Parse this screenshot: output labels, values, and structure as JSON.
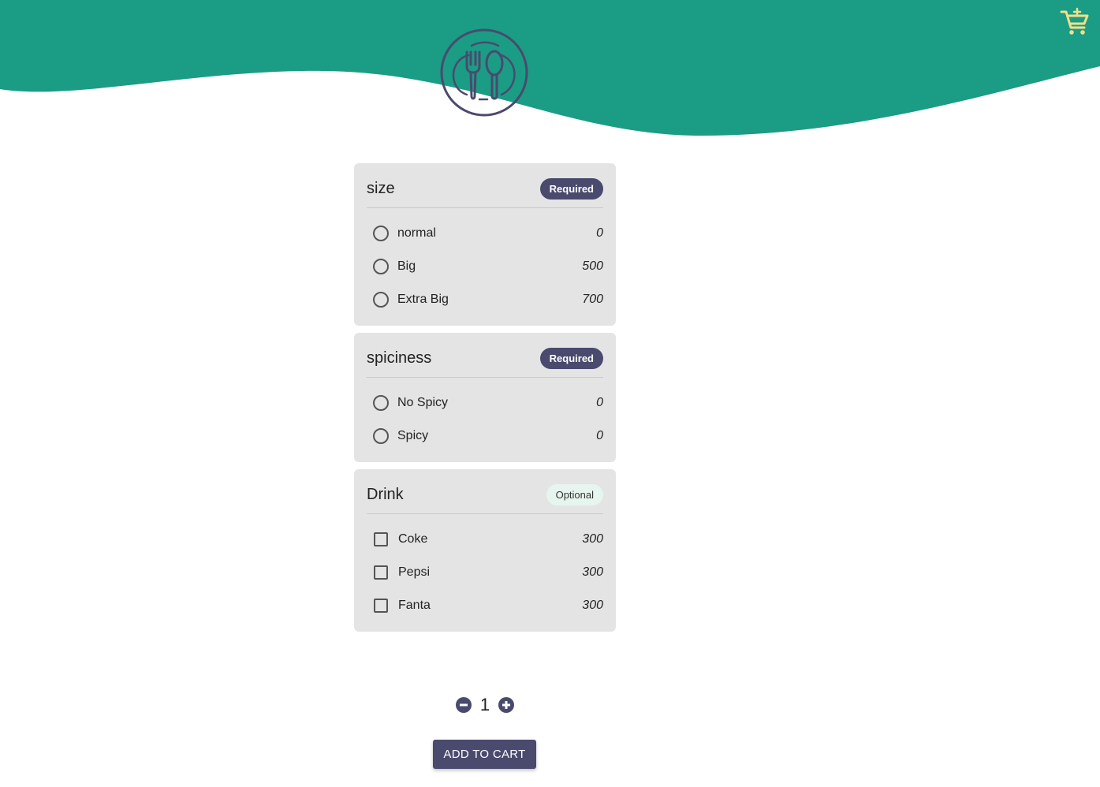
{
  "colors": {
    "header": "#1b9c85",
    "accent": "#4a4a6e",
    "cart": "#f2df8a",
    "panel": "#e4e4e4"
  },
  "header": {
    "logo_icon": "fork-spoon-logo-icon",
    "cart_icon": "add-to-cart-icon"
  },
  "groups": [
    {
      "title": "size",
      "badge": "Required",
      "input_type": "radio",
      "options": [
        {
          "label": "normal",
          "price": "0"
        },
        {
          "label": "Big",
          "price": "500"
        },
        {
          "label": "Extra Big",
          "price": "700"
        }
      ]
    },
    {
      "title": "spiciness",
      "badge": "Required",
      "input_type": "radio",
      "options": [
        {
          "label": "No Spicy",
          "price": "0"
        },
        {
          "label": "Spicy",
          "price": "0"
        }
      ]
    },
    {
      "title": "Drink",
      "badge": "Optional",
      "input_type": "checkbox",
      "options": [
        {
          "label": "Coke",
          "price": "300"
        },
        {
          "label": "Pepsi",
          "price": "300"
        },
        {
          "label": "Fanta",
          "price": "300"
        }
      ]
    }
  ],
  "quantity": {
    "value": "1",
    "decrease_icon": "minus-circle-icon",
    "increase_icon": "plus-circle-icon"
  },
  "add_to_cart_label": "ADD TO CART"
}
